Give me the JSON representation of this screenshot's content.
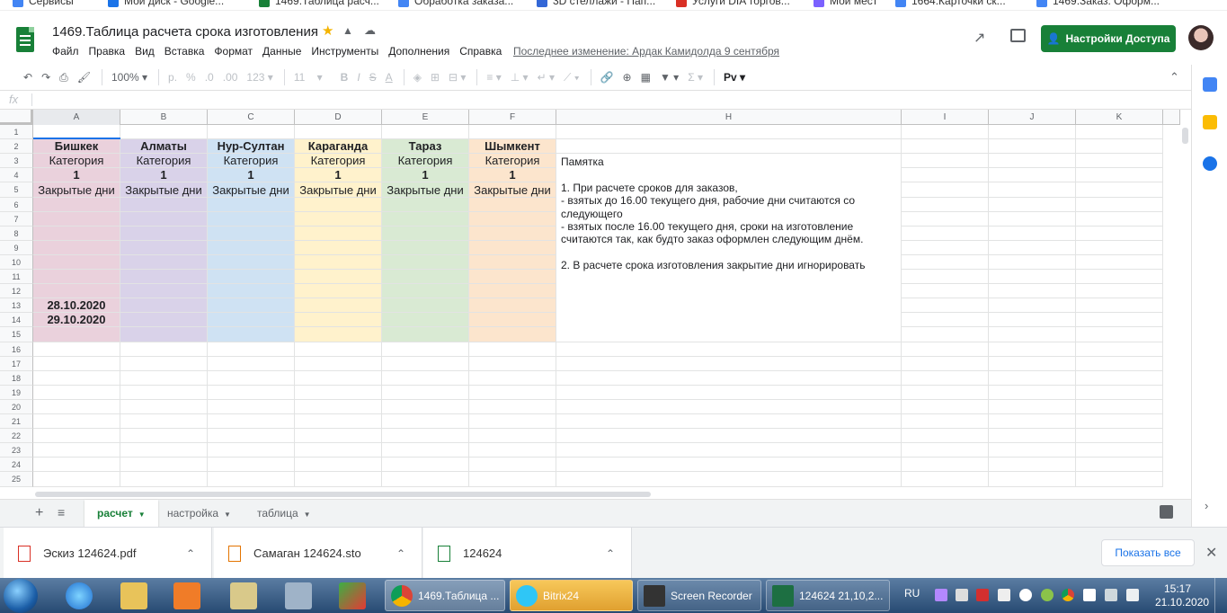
{
  "bookmarks": [
    "Сервисы",
    "Мой диск - Google...",
    "1469.Таблица расч...",
    "Обработка заказа...",
    "3D стеллажи - Пап...",
    "Услуги DIA торгов...",
    "Мой мест",
    "1664.Карточки ск...",
    "1469.Заказ. Оформ..."
  ],
  "doc": {
    "title": "1469.Таблица расчета срока изготовления",
    "menu": [
      "Файл",
      "Правка",
      "Вид",
      "Вставка",
      "Формат",
      "Данные",
      "Инструменты",
      "Дополнения",
      "Справка"
    ],
    "last_edit": "Последнее изменение: Ардак Камидолда 9 сентября",
    "share_label": "Настройки Доступа"
  },
  "toolbar": {
    "zoom": "100%",
    "currency": "р.",
    "percent": "%",
    "dec_less": ".0",
    "dec_more": ".00",
    "format_more": "123",
    "font_size": "11"
  },
  "formula_bar": {
    "fx": "fx",
    "value": ""
  },
  "columns": [
    "A",
    "B",
    "C",
    "D",
    "E",
    "F",
    "H",
    "I",
    "J",
    "K"
  ],
  "rows": [
    "1",
    "2",
    "3",
    "4",
    "5",
    "6",
    "7",
    "8",
    "9",
    "10",
    "11",
    "12",
    "13",
    "14",
    "15",
    "16",
    "17",
    "18",
    "19",
    "20",
    "21",
    "22",
    "23",
    "24",
    "25"
  ],
  "cities": [
    {
      "name": "Бишкек",
      "category": "Категория",
      "value": "1",
      "closed": "Закрытые дни",
      "color": "#ead1dc"
    },
    {
      "name": "Алматы",
      "category": "Категория",
      "value": "1",
      "closed": "Закрытые дни",
      "color": "#d9d2e9"
    },
    {
      "name": "Нур-Султан",
      "category": "Категория",
      "value": "1",
      "closed": "Закрытые дни",
      "color": "#cfe2f3"
    },
    {
      "name": "Караганда",
      "category": "Категория",
      "value": "1",
      "closed": "Закрытые дни",
      "color": "#fff2cc"
    },
    {
      "name": "Тараз",
      "category": "Категория",
      "value": "1",
      "closed": "Закрытые дни",
      "color": "#d9ead3"
    },
    {
      "name": "Шымкент",
      "category": "Категория",
      "value": "1",
      "closed": "Закрытые дни",
      "color": "#fce5cd"
    }
  ],
  "closed_dates": [
    "28.10.2020",
    "29.10.2020"
  ],
  "note": "Памятка\n\n1. При расчете сроков для заказов,\n- взятых до 16.00 текущего дня, рабочие дни считаются со следующего\n- взятых после 16.00 текущего дня, сроки на изготовление считаются так, как будто заказ оформлен следующим днём.\n\n2. В расчете срока  изготовления закрытие дни игнорировать",
  "sheet_tabs": [
    {
      "label": "расчет",
      "active": true
    },
    {
      "label": "настройка",
      "active": false
    },
    {
      "label": "таблица",
      "active": false
    }
  ],
  "downloads": {
    "items": [
      "Эскиз 124624.pdf",
      "Самаган 124624.sto",
      "124624"
    ],
    "show_all": "Показать все"
  },
  "taskbar": {
    "tasks": [
      "1469.Таблица ...",
      "Bitrix24",
      "Screen Recorder",
      "124624 21,10,2..."
    ],
    "lang": "RU",
    "time": "15:17",
    "date": "21.10.2020"
  }
}
